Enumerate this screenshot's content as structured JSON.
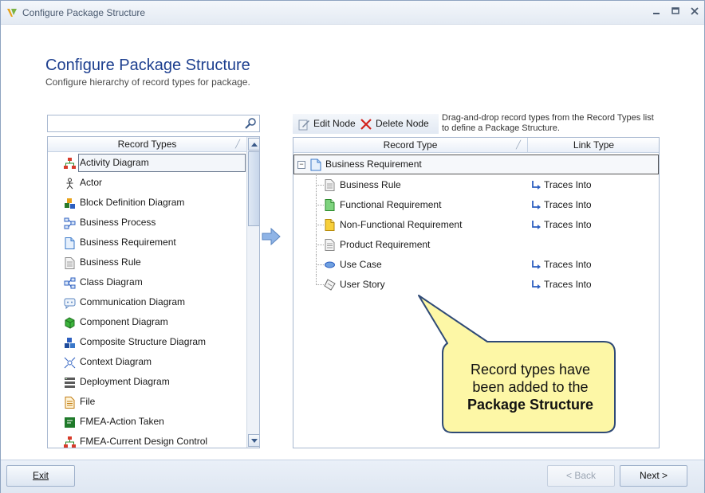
{
  "window": {
    "title": "Configure Package Structure"
  },
  "header": {
    "title": "Configure Package Structure",
    "subtitle": "Configure hierarchy of record types for package."
  },
  "search": {
    "value": "",
    "placeholder": ""
  },
  "record_types": {
    "header": "Record Types",
    "items": [
      {
        "label": "Activity Diagram",
        "icon": "activity-diagram-icon",
        "selected": true
      },
      {
        "label": "Actor",
        "icon": "actor-icon"
      },
      {
        "label": "Block Definition Diagram",
        "icon": "block-definition-icon"
      },
      {
        "label": "Business Process",
        "icon": "business-process-icon"
      },
      {
        "label": "Business Requirement",
        "icon": "document-icon"
      },
      {
        "label": "Business Rule",
        "icon": "rule-document-icon"
      },
      {
        "label": "Class Diagram",
        "icon": "class-diagram-icon"
      },
      {
        "label": "Communication Diagram",
        "icon": "communication-diagram-icon"
      },
      {
        "label": "Component Diagram",
        "icon": "component-cube-icon"
      },
      {
        "label": "Composite Structure Diagram",
        "icon": "composite-structure-icon"
      },
      {
        "label": "Context Diagram",
        "icon": "context-diagram-icon"
      },
      {
        "label": "Deployment Diagram",
        "icon": "deployment-diagram-icon"
      },
      {
        "label": "File",
        "icon": "file-icon"
      },
      {
        "label": "FMEA-Action Taken",
        "icon": "fmea-action-icon"
      },
      {
        "label": "FMEA-Current Design Control",
        "icon": "fmea-control-icon"
      }
    ]
  },
  "toolbar": {
    "edit_label": "Edit Node",
    "delete_label": "Delete Node"
  },
  "hint": "Drag-and-drop record types from the Record Types list to define a Package Structure.",
  "structure": {
    "col_record_type": "Record Type",
    "col_link_type": "Link Type",
    "root": "Business Requirement",
    "children": [
      {
        "label": "Business Rule",
        "link": "Traces Into",
        "icon": "rule-document-icon"
      },
      {
        "label": "Functional Requirement",
        "link": "Traces Into",
        "icon": "green-document-icon"
      },
      {
        "label": "Non-Functional Requirement",
        "link": "Traces Into",
        "icon": "yellow-document-icon"
      },
      {
        "label": "Product Requirement",
        "link": "",
        "icon": "rule-document-icon"
      },
      {
        "label": "Use Case",
        "link": "Traces Into",
        "icon": "use-case-ellipse-icon"
      },
      {
        "label": "User Story",
        "link": "Traces Into",
        "icon": "user-story-icon"
      }
    ]
  },
  "callout": {
    "line1": "Record types have",
    "line2": "been added to the",
    "line3": "Package Structure"
  },
  "footer": {
    "exit_label": "Exit",
    "back_label": "< Back",
    "next_label": "Next >"
  },
  "colors": {
    "title_blue": "#1d3f8f",
    "callout_fill": "#fdf7a6",
    "callout_border": "#2f4a76"
  }
}
